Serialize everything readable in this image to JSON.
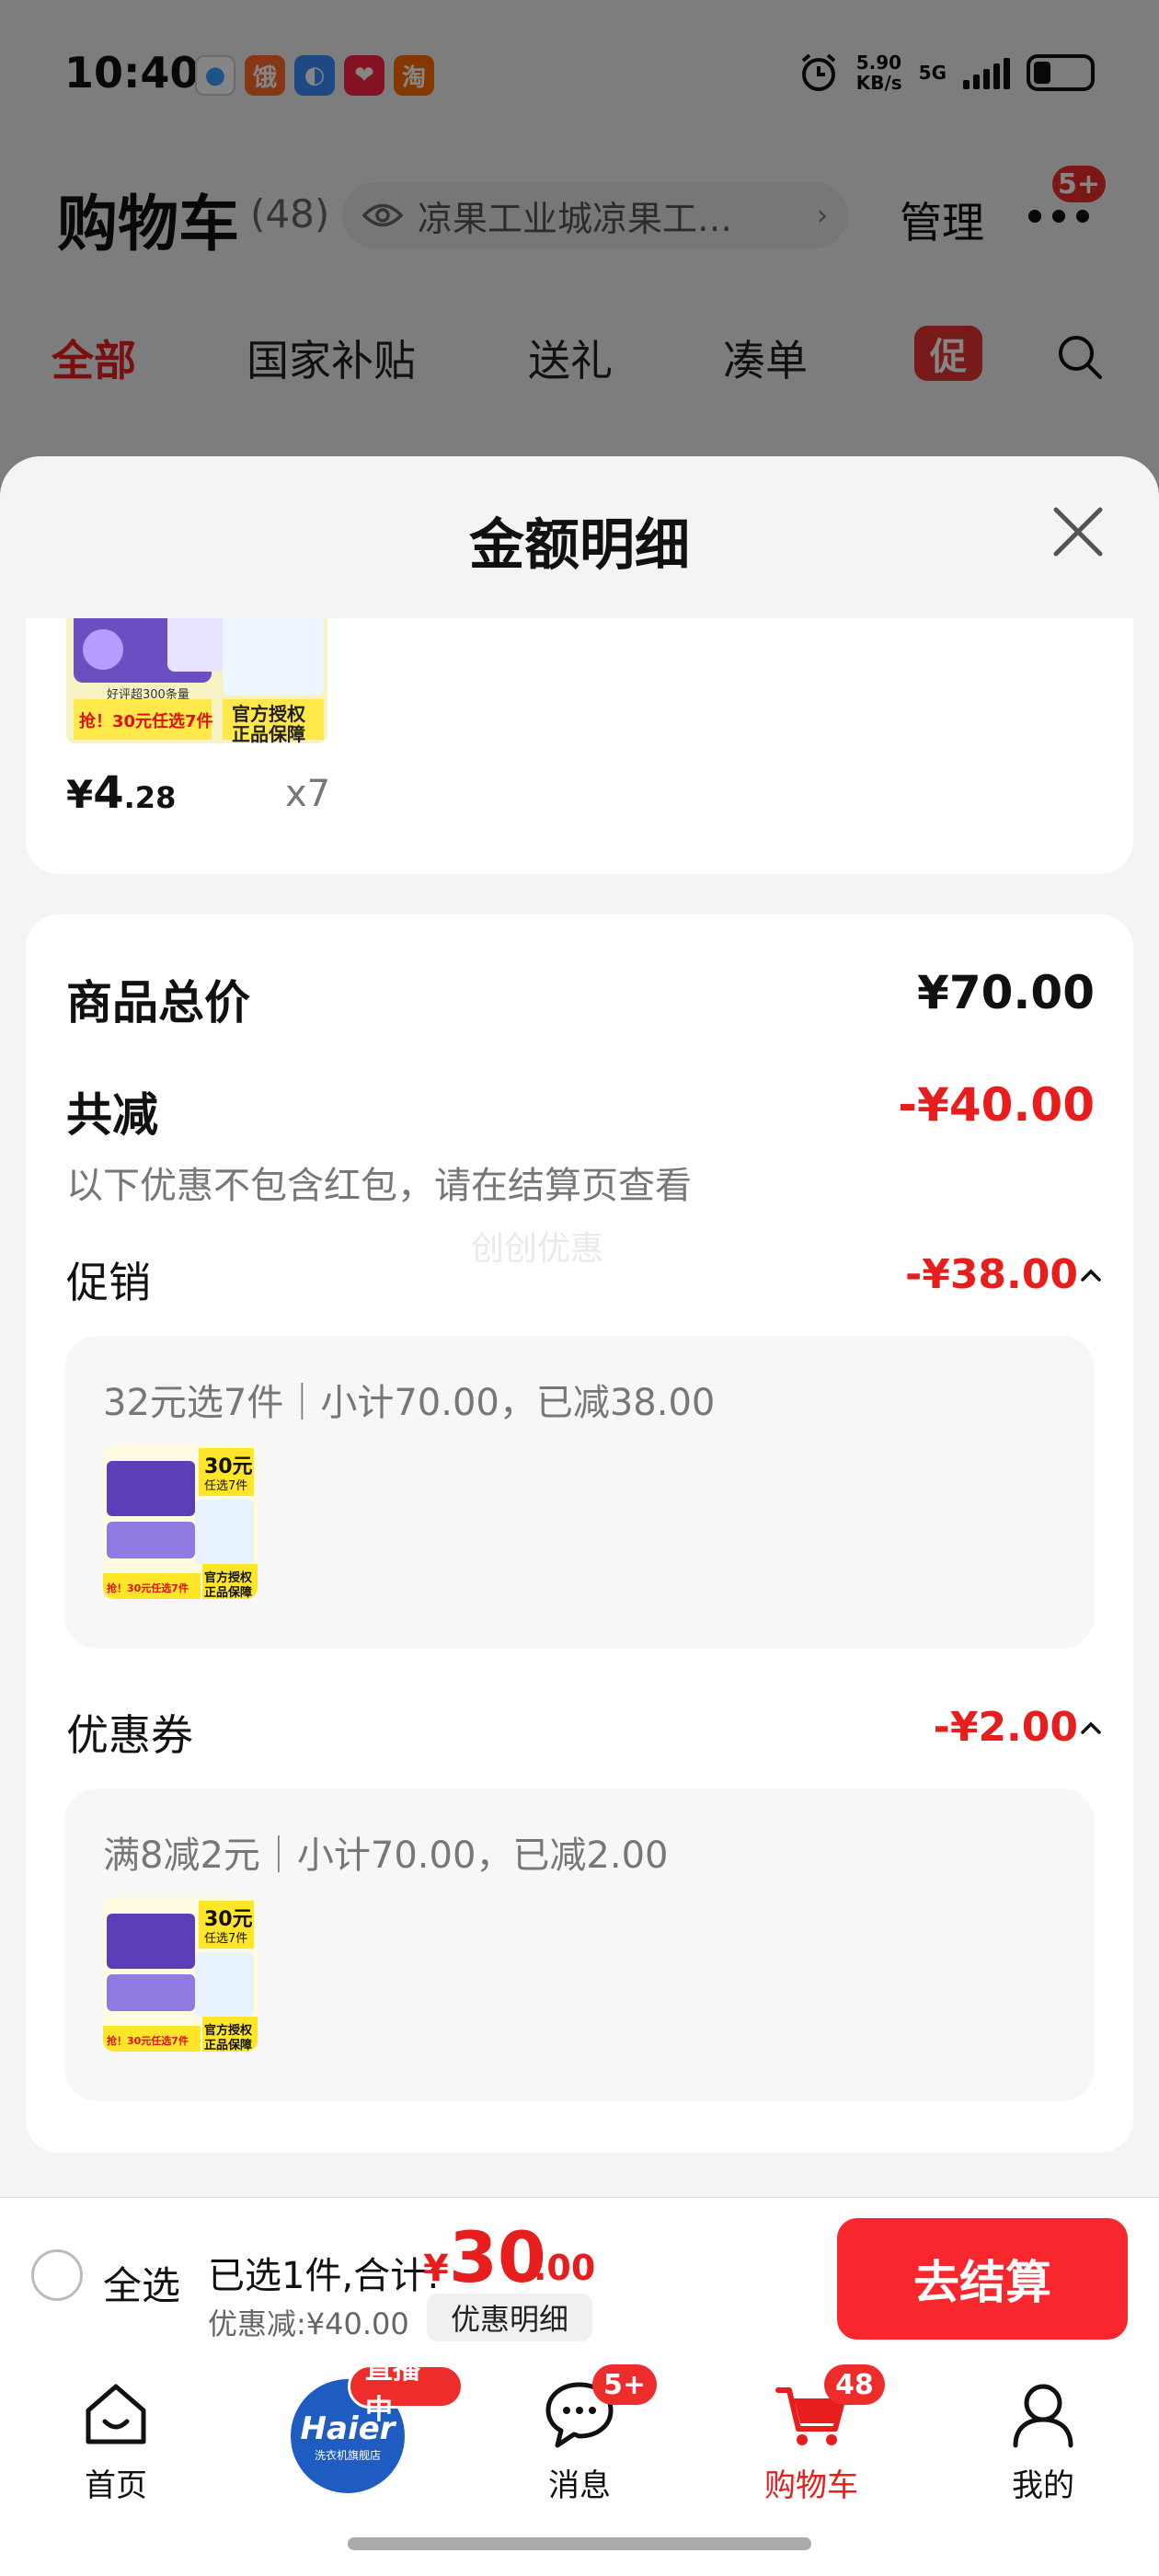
{
  "status_bar": {
    "time": "10:40",
    "apps": [
      {
        "icon": "app-icon-1",
        "glyph": "●",
        "color": "#ffffff"
      },
      {
        "icon": "app-icon-2",
        "glyph": "饿",
        "color": "#ff6a2b"
      },
      {
        "icon": "app-icon-3",
        "glyph": "◐",
        "color": "#3c8cff"
      },
      {
        "icon": "app-icon-4",
        "glyph": "❤",
        "color": "#ff2442"
      },
      {
        "icon": "app-icon-5",
        "glyph": "淘",
        "color": "#ff6a00"
      }
    ],
    "net_speed_value": "5.90",
    "net_speed_unit": "KB/s",
    "network": "5G"
  },
  "cart_header": {
    "title": "购物车",
    "count": "(48)",
    "address": "凉果工业城凉果工…",
    "manage": "管理",
    "more_badge": "5+"
  },
  "category_tabs": [
    {
      "label": "全部",
      "active": true
    },
    {
      "label": "国家补贴",
      "active": false
    },
    {
      "label": "送礼",
      "active": false
    },
    {
      "label": "凑单",
      "active": false
    }
  ],
  "category_promo": "促",
  "sheet": {
    "title": "金额明细",
    "previous_item": {
      "price_symbol": "¥",
      "price_int": "4",
      "price_dec": ".28",
      "quantity": "x7",
      "image_text": [
        "好评超300条量",
        "抢！30元任选7件",
        "官方授权",
        "正品保障"
      ]
    },
    "summary": {
      "total_label": "商品总价",
      "total_value": "¥70.00",
      "reduced_label": "共减",
      "reduced_value": "-¥40.00",
      "note": "以下优惠不包含红包，请在结算页查看",
      "watermark": "创创优惠"
    },
    "promotion": {
      "label": "促销",
      "value": "-¥38.00",
      "rule": "32元选7件｜小计70.00，已减38.00",
      "thumb_text": [
        "30元",
        "任选7件",
        "抢！30元任选7件",
        "官方授权",
        "正品保障"
      ]
    },
    "coupon": {
      "label": "优惠券",
      "value": "-¥2.00",
      "rule": "满8减2元｜小计70.00，已减2.00",
      "thumb_text": [
        "30元",
        "任选7件",
        "抢！30元任选7件",
        "官方授权",
        "正品保障"
      ]
    }
  },
  "checkout": {
    "select_all": "全选",
    "selected_info": "已选1件,合计:",
    "total_symbol": "¥",
    "total_int": "30",
    "total_dec": ".00",
    "discount_line": "优惠减:¥40.00",
    "detail_button": "优惠明细",
    "checkout_button": "去结算"
  },
  "tab_bar": [
    {
      "label": "首页",
      "icon": "home-icon",
      "active": false
    },
    {
      "label": "",
      "icon": "haier-store-icon",
      "active": false,
      "brand": "Haier",
      "brand_sub": "洗衣机旗舰店",
      "badge": "直播中"
    },
    {
      "label": "消息",
      "icon": "message-icon",
      "active": false,
      "badge": "5+"
    },
    {
      "label": "购物车",
      "icon": "cart-icon",
      "active": true,
      "badge": "48"
    },
    {
      "label": "我的",
      "icon": "profile-icon",
      "active": false
    }
  ],
  "colors": {
    "accent_red": "#e81e1e",
    "checkout_red": "#f8262d",
    "brand_blue": "#1f5cc2"
  }
}
